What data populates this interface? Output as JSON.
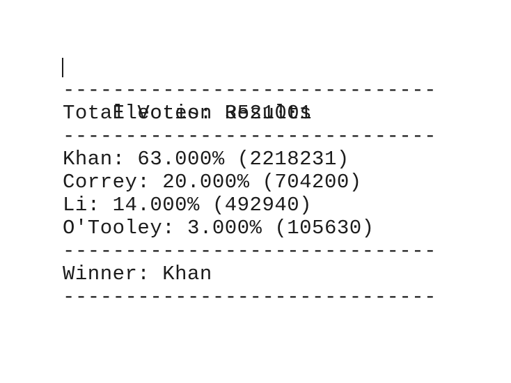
{
  "title": "Election Results",
  "separator": "------------------------------",
  "total_votes": "Total Votes: 3521001",
  "candidates": [
    "Khan: 63.000% (2218231)",
    "Correy: 20.000% (704200)",
    "Li: 14.000% (492940)",
    "O'Tooley: 3.000% (105630)"
  ],
  "winner": "Winner: Khan"
}
